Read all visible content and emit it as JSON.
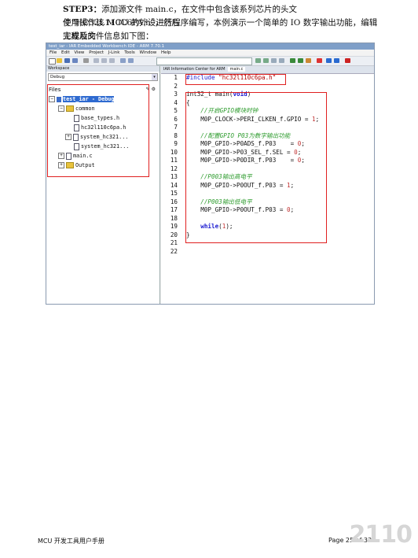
{
  "para": {
    "line1_bold": "STEP3：",
    "line1_text": "添加源文件 main.c，在文件中包含该系列芯片的头文件“HC32L110C6PA.h”，然后",
    "line2": "使用操作该 MCU 的外设进行程序编写，本例演示一个简单的 IO 数字输出功能，编辑完成后的",
    "line3": "工程及文件信息如下图："
  },
  "ide": {
    "title": "test_iar - IAR Embedded Workbench IDE - ARM 7.70.1",
    "menu": [
      "File",
      "Edit",
      "View",
      "Project",
      "J-Link",
      "Tools",
      "Window",
      "Help"
    ],
    "workspace_label": "Workspace",
    "config": "Debug",
    "files_header": "Files",
    "tree": [
      {
        "label": "test_iar - Debug"
      },
      {
        "label": "common"
      },
      {
        "label": "base_types.h"
      },
      {
        "label": "hc32l110c6pa.h"
      },
      {
        "label": "system_hc321..."
      },
      {
        "label": "system_hc321..."
      },
      {
        "label": "main.c"
      },
      {
        "label": "Output"
      }
    ],
    "tabs": [
      "IAR Information Center for ARM",
      "main.c"
    ],
    "line_numbers": [
      "1",
      "2",
      "3",
      "4",
      "5",
      "6",
      "7",
      "8",
      "9",
      "10",
      "11",
      "12",
      "13",
      "14",
      "15",
      "16",
      "17",
      "18",
      "19",
      "20",
      "21",
      "22"
    ],
    "code": {
      "l1_kw": "#include ",
      "l1_str": "\"hc32l110c6pa.h\"",
      "l3_a": "int32_t main(",
      "l3_kw": "void",
      "l3_b": ")",
      "l4": "{",
      "l5": "    //开启GPIO模块时钟",
      "l6_a": "    M0P_CLOCK->PERI_CLKEN_f.GPIO = ",
      "l6_n": "1",
      "l6_b": ";",
      "l8": "    //配置GPIO P03为数字输出功能",
      "l9_a": "    M0P_GPIO->P0ADS_f.P03    = ",
      "l9_n": "0",
      "l9_b": ";",
      "l10_a": "    M0P_GPIO->P03_SEL_f.SEL = ",
      "l10_n": "0",
      "l10_b": ";",
      "l11_a": "    M0P_GPIO->P0DIR_f.P03    = ",
      "l11_n": "0",
      "l11_b": ";",
      "l13": "    //P003输出高电平",
      "l14_a": "    M0P_GPIO->P0OUT_f.P03 = ",
      "l14_n": "1",
      "l14_b": ";",
      "l16": "    //P003输出低电平",
      "l17_a": "    M0P_GPIO->P0OUT_f.P03 = ",
      "l17_n": "0",
      "l17_b": ";",
      "l19_kw": "    while",
      "l19_a": "(",
      "l19_n": "1",
      "l19_b": ");",
      "l20": "}"
    }
  },
  "footer": {
    "left": "MCU 开发工具用户手册",
    "right": "Page 25 of 33"
  },
  "watermark": "2110"
}
